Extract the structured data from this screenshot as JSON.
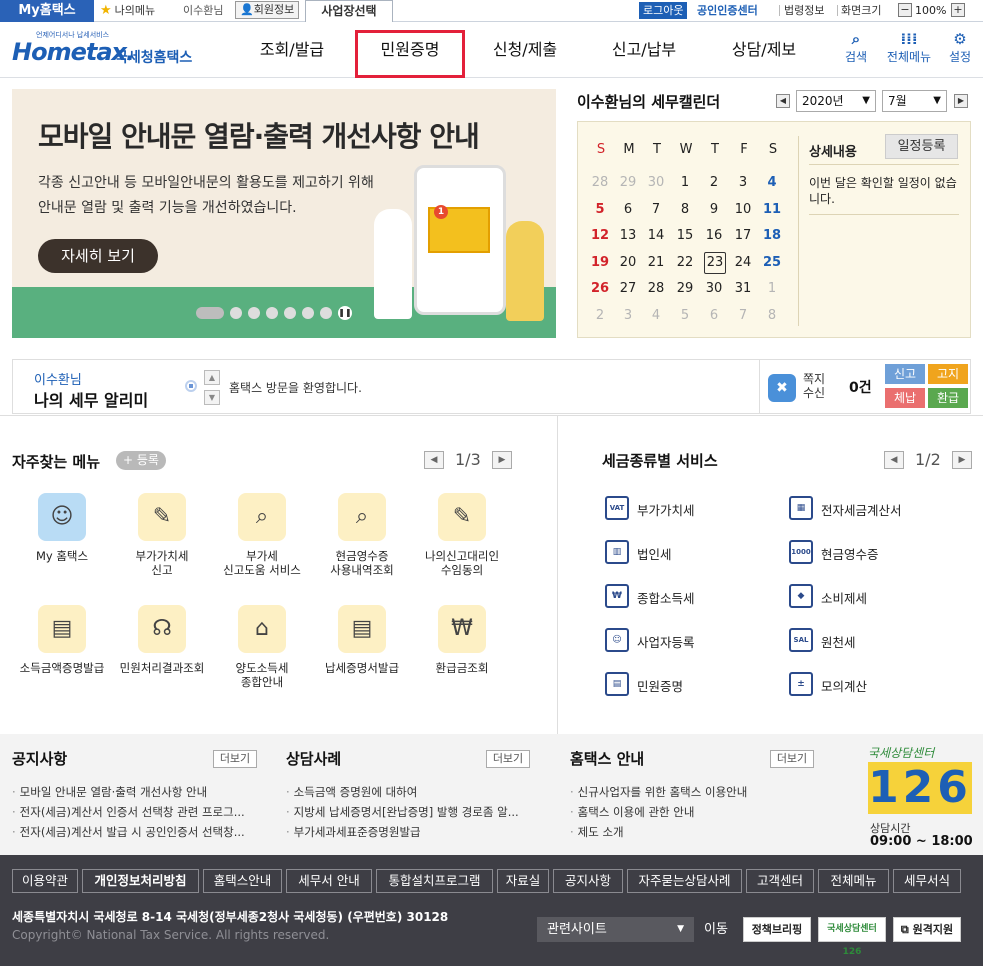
{
  "topbar": {
    "my_home": "My홈택스",
    "my_menu": "나의메뉴",
    "user_name": "이수환님",
    "member_info": "회원정보",
    "biz_select": "사업장선택",
    "logout": "로그아웃",
    "cert_center": "공인인증센터",
    "law_info": "법령정보",
    "screen_size": "화면크기",
    "zoom": "100%"
  },
  "header": {
    "logo_small": "언제어디서나 납세서비스",
    "logo_main": "Hometax.",
    "logo_kr": "국세청홈택스",
    "gnb": [
      "조회/발급",
      "민원증명",
      "신청/제출",
      "신고/납부",
      "상담/제보"
    ],
    "search": "검색",
    "all_menu": "전체메뉴",
    "settings": "설정"
  },
  "banner": {
    "title": "모바일 안내문 열람·출력 개선사항 안내",
    "desc_line1": "각종 신고안내 등 모바일안내문의 활용도를 제고하기 위해",
    "desc_line2": "안내문 열람 및 출력 기능을 개선하였습니다.",
    "more": "자세히 보기",
    "badge": "1"
  },
  "calendar": {
    "title": "이수환님의 세무캘린더",
    "year": "2020년",
    "month": "7월",
    "weekdays": [
      "S",
      "M",
      "T",
      "W",
      "T",
      "F",
      "S"
    ],
    "weeks": [
      [
        "28",
        "29",
        "30",
        "1",
        "2",
        "3",
        "4"
      ],
      [
        "5",
        "6",
        "7",
        "8",
        "9",
        "10",
        "11"
      ],
      [
        "12",
        "13",
        "14",
        "15",
        "16",
        "17",
        "18"
      ],
      [
        "19",
        "20",
        "21",
        "22",
        "23",
        "24",
        "25"
      ],
      [
        "26",
        "27",
        "28",
        "29",
        "30",
        "31",
        "1"
      ],
      [
        "2",
        "3",
        "4",
        "5",
        "6",
        "7",
        "8"
      ]
    ],
    "detail_title": "상세내용",
    "register": "일정등록",
    "detail_text": "이번 달은 확인할 일정이 없습니다."
  },
  "notify": {
    "who": "이수환님",
    "title": "나의 세무 알리미",
    "message": "홈택스 방문을 환영합니다.",
    "note_label": "쪽지 수신",
    "note_count": "0건",
    "btn_apply": "신고",
    "btn_notice": "고지",
    "btn_arrears": "체납",
    "btn_refund": "환급",
    "colors": {
      "apply": "#6fa0d8",
      "notice": "#f0a41d",
      "arrears": "#ea6f6f",
      "refund": "#5aa84f"
    }
  },
  "favorites": {
    "title": "자주찾는 메뉴",
    "register": "등록",
    "page": "1/3",
    "items": [
      {
        "icon": "person-icon",
        "glyph": "☺",
        "label1": "My 홈택스",
        "label2": ""
      },
      {
        "icon": "vat-report-icon",
        "glyph": "✎",
        "label1": "부가가치세",
        "label2": "신고"
      },
      {
        "icon": "vat-help-icon",
        "glyph": "⌕",
        "label1": "부가세",
        "label2": "신고도움 서비스"
      },
      {
        "icon": "cash-receipt-icon",
        "glyph": "⌕",
        "label1": "현금영수증",
        "label2": "사용내역조회"
      },
      {
        "icon": "agent-consent-icon",
        "glyph": "✎",
        "label1": "나의신고대리인",
        "label2": "수임동의"
      },
      {
        "icon": "income-cert-icon",
        "glyph": "▤",
        "label1": "소득금액증명발급",
        "label2": ""
      },
      {
        "icon": "headset-icon",
        "glyph": "☊",
        "label1": "민원처리결과조회",
        "label2": ""
      },
      {
        "icon": "house-icon",
        "glyph": "⌂",
        "label1": "양도소득세",
        "label2": "종합안내"
      },
      {
        "icon": "tax-cert-icon",
        "glyph": "▤",
        "label1": "납세증명서발급",
        "label2": ""
      },
      {
        "icon": "refund-icon",
        "glyph": "₩",
        "label1": "환급금조회",
        "label2": ""
      }
    ]
  },
  "tax_services": {
    "title": "세금종류별 서비스",
    "page": "1/2",
    "items": [
      {
        "icon": "vat-icon",
        "glyph": "VAT",
        "label": "부가가치세"
      },
      {
        "icon": "e-invoice-icon",
        "glyph": "▦",
        "label": "전자세금계산서"
      },
      {
        "icon": "corporate-icon",
        "glyph": "▥",
        "label": "법인세"
      },
      {
        "icon": "receipt-icon",
        "glyph": "1000",
        "label": "현금영수증"
      },
      {
        "icon": "income-tax-icon",
        "glyph": "₩",
        "label": "종합소득세"
      },
      {
        "icon": "diamond-icon",
        "glyph": "◆",
        "label": "소비제세"
      },
      {
        "icon": "business-reg-icon",
        "glyph": "☺",
        "label": "사업자등록"
      },
      {
        "icon": "withholding-icon",
        "glyph": "SAL",
        "label": "원천세"
      },
      {
        "icon": "civil-cert-icon",
        "glyph": "▤",
        "label": "민원증명"
      },
      {
        "icon": "calculator-icon",
        "glyph": "±",
        "label": "모의계산"
      }
    ]
  },
  "news": {
    "more": "더보기",
    "notice": {
      "title": "공지사항",
      "items": [
        "모바일 안내문 열람·출력 개선사항 안내",
        "전자(세금)계산서 인증서 선택창 관련 프로그...",
        "전자(세금)계산서 발급 시 공인인증서 선택창..."
      ]
    },
    "counsel": {
      "title": "상담사례",
      "items": [
        "소득금액 증명원에 대하여",
        "지방세 납세증명서[완납증명] 발행 경로좀 알...",
        "부가세과세표준증명원발급"
      ]
    },
    "guide": {
      "title": "홈택스 안내",
      "items": [
        "신규사업자를 위한 홈택스 이용안내",
        "홈택스 이용에 관한 안내",
        "제도 소개"
      ]
    },
    "center_title": "국세상담센터",
    "center_number": "126",
    "center_hours_label": "상담시간",
    "center_hours": "09:00 ~ 18:00"
  },
  "footer": {
    "links": [
      "이용약관",
      "개인정보처리방침",
      "홈택스안내",
      "세무서 안내",
      "통합설치프로그램",
      "자료실",
      "공지사항",
      "자주묻는상담사례",
      "고객센터",
      "전체메뉴",
      "세무서식"
    ],
    "address": "세종특별자치시 국세청로 8-14 국세청(정부세종2청사 국세청동) (우편번호) 30128",
    "copyright": "Copyright© National Tax Service. All rights reserved.",
    "related": "관련사이트",
    "go": "이동",
    "btn_briefing": "정책브리핑",
    "btn_126": "국세상담센터 126",
    "btn_remote": "원격지원"
  }
}
